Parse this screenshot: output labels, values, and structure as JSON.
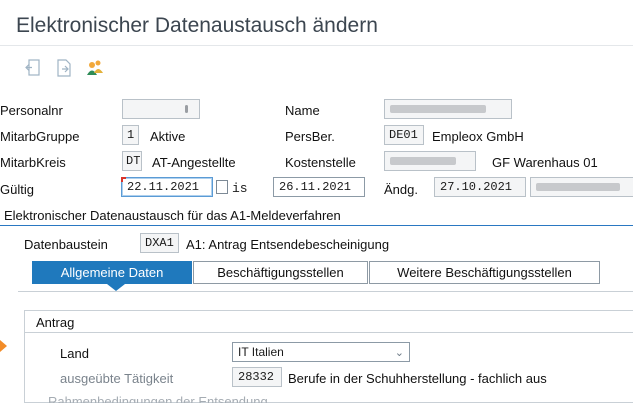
{
  "window": {
    "title": "Elektronischer Datenaustausch ändern"
  },
  "toolbar": {
    "icons": [
      "exit-icon",
      "document-icon",
      "people-icon"
    ]
  },
  "header": {
    "personalnr": {
      "label": "Personalnr",
      "value": ""
    },
    "name": {
      "label": "Name",
      "value": ""
    },
    "mitarbgruppe": {
      "label": "MitarbGruppe",
      "code": "1",
      "text": "Aktive"
    },
    "persber": {
      "label": "PersBer.",
      "code": "DE01",
      "text": "Empleox GmbH"
    },
    "mitarbkreis": {
      "label": "MitarbKreis",
      "code": "DT",
      "text": "AT-Angestellte"
    },
    "kostenstelle": {
      "label": "Kostenstelle",
      "text": "GF Warenhaus 01"
    },
    "gueltig": {
      "label": "Gültig",
      "from": "22.11.2021",
      "bis_label": "is",
      "to": "26.11.2021"
    },
    "aendg": {
      "label": "Ändg.",
      "date": "27.10.2021"
    }
  },
  "section": {
    "title": "Elektronischer Datenaustausch für das A1-Meldeverfahren"
  },
  "datenbaustein": {
    "label": "Datenbaustein",
    "code": "DXA1",
    "text": "A1: Antrag Entsendebescheinigung"
  },
  "tabs": [
    {
      "label": "Allgemeine Daten",
      "active": true
    },
    {
      "label": "Beschäftigungsstellen",
      "active": false
    },
    {
      "label": "Weitere Beschäftigungsstellen",
      "active": false
    }
  ],
  "antrag": {
    "title": "Antrag",
    "land": {
      "label": "Land",
      "value": "IT Italien"
    },
    "taetigkeit": {
      "label": "ausgeübte Tätigkeit",
      "code": "28332",
      "text": "Berufe in der Schuhherstellung - fachlich aus"
    },
    "rahmen": {
      "label": "Rahmenbedingungen der Entsendung"
    }
  },
  "colors": {
    "accent": "#1f79bd",
    "orange": "#f28c28",
    "title": "#3c4650"
  }
}
